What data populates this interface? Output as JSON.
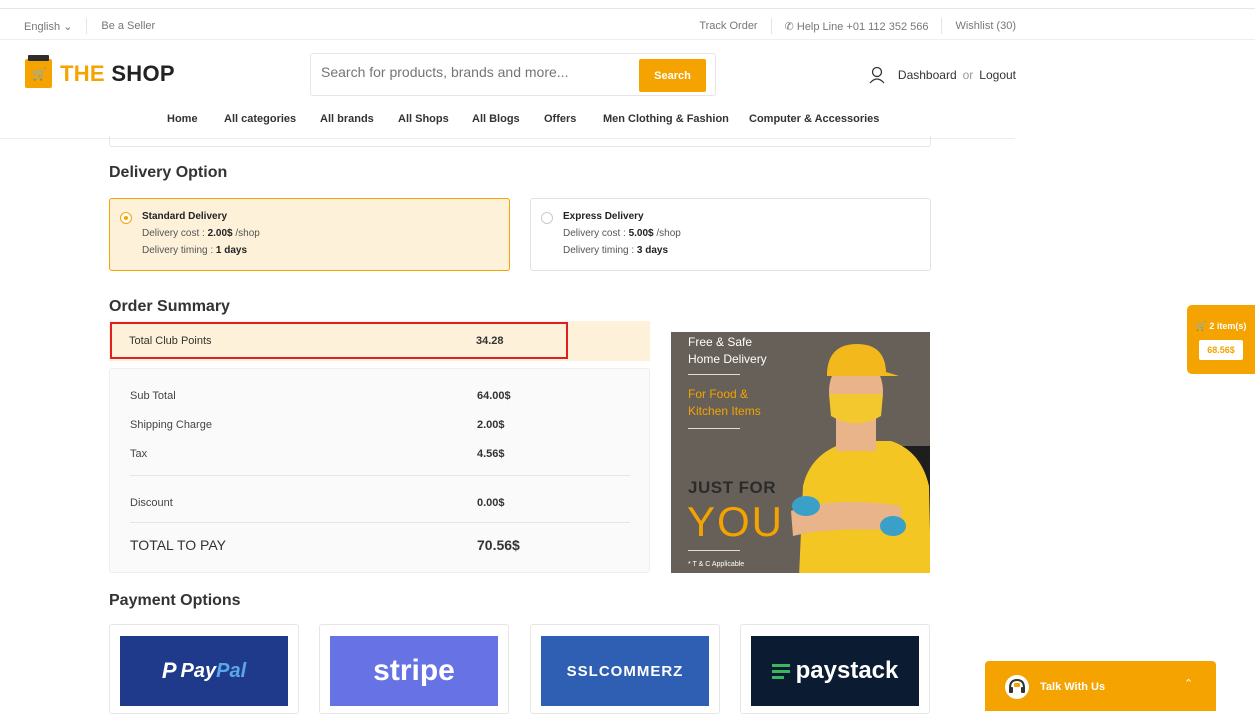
{
  "topbar": {
    "language": "English",
    "be_seller": "Be a Seller",
    "track_order": "Track Order",
    "help_line": "Help Line +01 112 352 566",
    "wishlist": "Wishlist (30)"
  },
  "brand": {
    "name_accent": "THE",
    "name_rest": "SHOP"
  },
  "search": {
    "placeholder": "Search for products, brands and more...",
    "button": "Search"
  },
  "account": {
    "dashboard": "Dashboard",
    "or": "or",
    "logout": "Logout"
  },
  "nav": [
    "Home",
    "All categories",
    "All brands",
    "All Shops",
    "All Blogs",
    "Offers",
    "Men Clothing & Fashion",
    "Computer & Accessories"
  ],
  "delivery": {
    "heading": "Delivery Option",
    "options": [
      {
        "title": "Standard Delivery",
        "cost_label": "Delivery cost : ",
        "cost": "2.00$",
        "cost_unit": " /shop",
        "timing_label": "Delivery timing : ",
        "timing": "1 days",
        "selected": true
      },
      {
        "title": "Express Delivery",
        "cost_label": "Delivery cost : ",
        "cost": "5.00$",
        "cost_unit": " /shop",
        "timing_label": "Delivery timing : ",
        "timing": "3 days",
        "selected": false
      }
    ]
  },
  "summary": {
    "heading": "Order Summary",
    "club_points_label": "Total Club Points",
    "club_points": "34.28",
    "rows": [
      {
        "label": "Sub Total",
        "value": "64.00$"
      },
      {
        "label": "Shipping Charge",
        "value": "2.00$"
      },
      {
        "label": "Tax",
        "value": "4.56$"
      },
      {
        "label": "Discount",
        "value": "0.00$"
      }
    ],
    "total_label": "TOTAL TO PAY",
    "total": "70.56$"
  },
  "promo": {
    "line1": "Free & Safe",
    "line2": "Home Delivery",
    "line3": "For Food &",
    "line4": "Kitchen Items",
    "line5": "JUST FOR",
    "line6": "YOU",
    "note": "* T & C Applicable"
  },
  "payment": {
    "heading": "Payment Options",
    "methods": [
      {
        "name": "PayPal",
        "part1": "Pay",
        "part2": "Pal",
        "bg": "#1f3a8a"
      },
      {
        "name": "stripe",
        "bg": "#6772e5"
      },
      {
        "name": "SSLCOMMERZ",
        "bg": "#2f5fb3"
      },
      {
        "name": "paystack",
        "bg": "#0b1b31"
      }
    ]
  },
  "cart_float": {
    "items": "2 item(s)",
    "total": "68.56$"
  },
  "chat": {
    "label": "Talk With Us"
  },
  "colors": {
    "accent": "#f4a300",
    "highlight": "#e02020",
    "soft": "#fdf1d9"
  }
}
